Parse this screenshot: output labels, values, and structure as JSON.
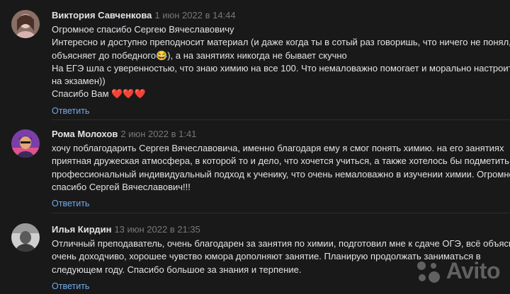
{
  "comments": [
    {
      "author": "Виктория Савченкова",
      "date": "1 июн 2022 в 14:44",
      "lines": [
        "Огромное спасибо Сергею Вячеславовичу",
        "Интересно и доступно преподносит материал (и даже когда ты в сотый раз говоришь, что ничего не понял,",
        "объясняет до победного😂), а на занятиях никогда не бывает скучно",
        "На ЕГЭ шла с уверенностью, что знаю химию на все 100. Что немаловажно помогает и морально настроиться",
        "на экзамен))",
        "Спасибо Вам ❤️❤️❤️"
      ],
      "reply": "Ответить"
    },
    {
      "author": "Рома Молохов",
      "date": "2 июн 2022 в 1:41",
      "lines": [
        "хочу поблагодарить Сергея Вячеславовича, именно благодаря ему я смог понять химию. на его занятиях",
        "приятная дружеская атмосфера, в которой то и дело, что хочется учиться, а также хотелось бы подметить",
        "профессиональный индивидуальный подход к ученику, что очень немаловажно в изучении химии. Огромное",
        "спасибо Сергей Вячеславович!!!"
      ],
      "reply": "Ответить"
    },
    {
      "author": "Илья Кирдин",
      "date": "13 июн 2022 в 21:35",
      "lines": [
        "Отличный преподаватель, очень благодарен за занятия по химии, подготовил мне к сдаче ОГЭ, всё объясняет",
        "очень доходчиво, хорошее чувство юмора дополняют занятие. Планирую продолжать заниматься в",
        "следующем году. Спасибо большое за знания и терпение."
      ],
      "reply": "Ответить"
    }
  ],
  "watermark": {
    "text": "Avito"
  }
}
